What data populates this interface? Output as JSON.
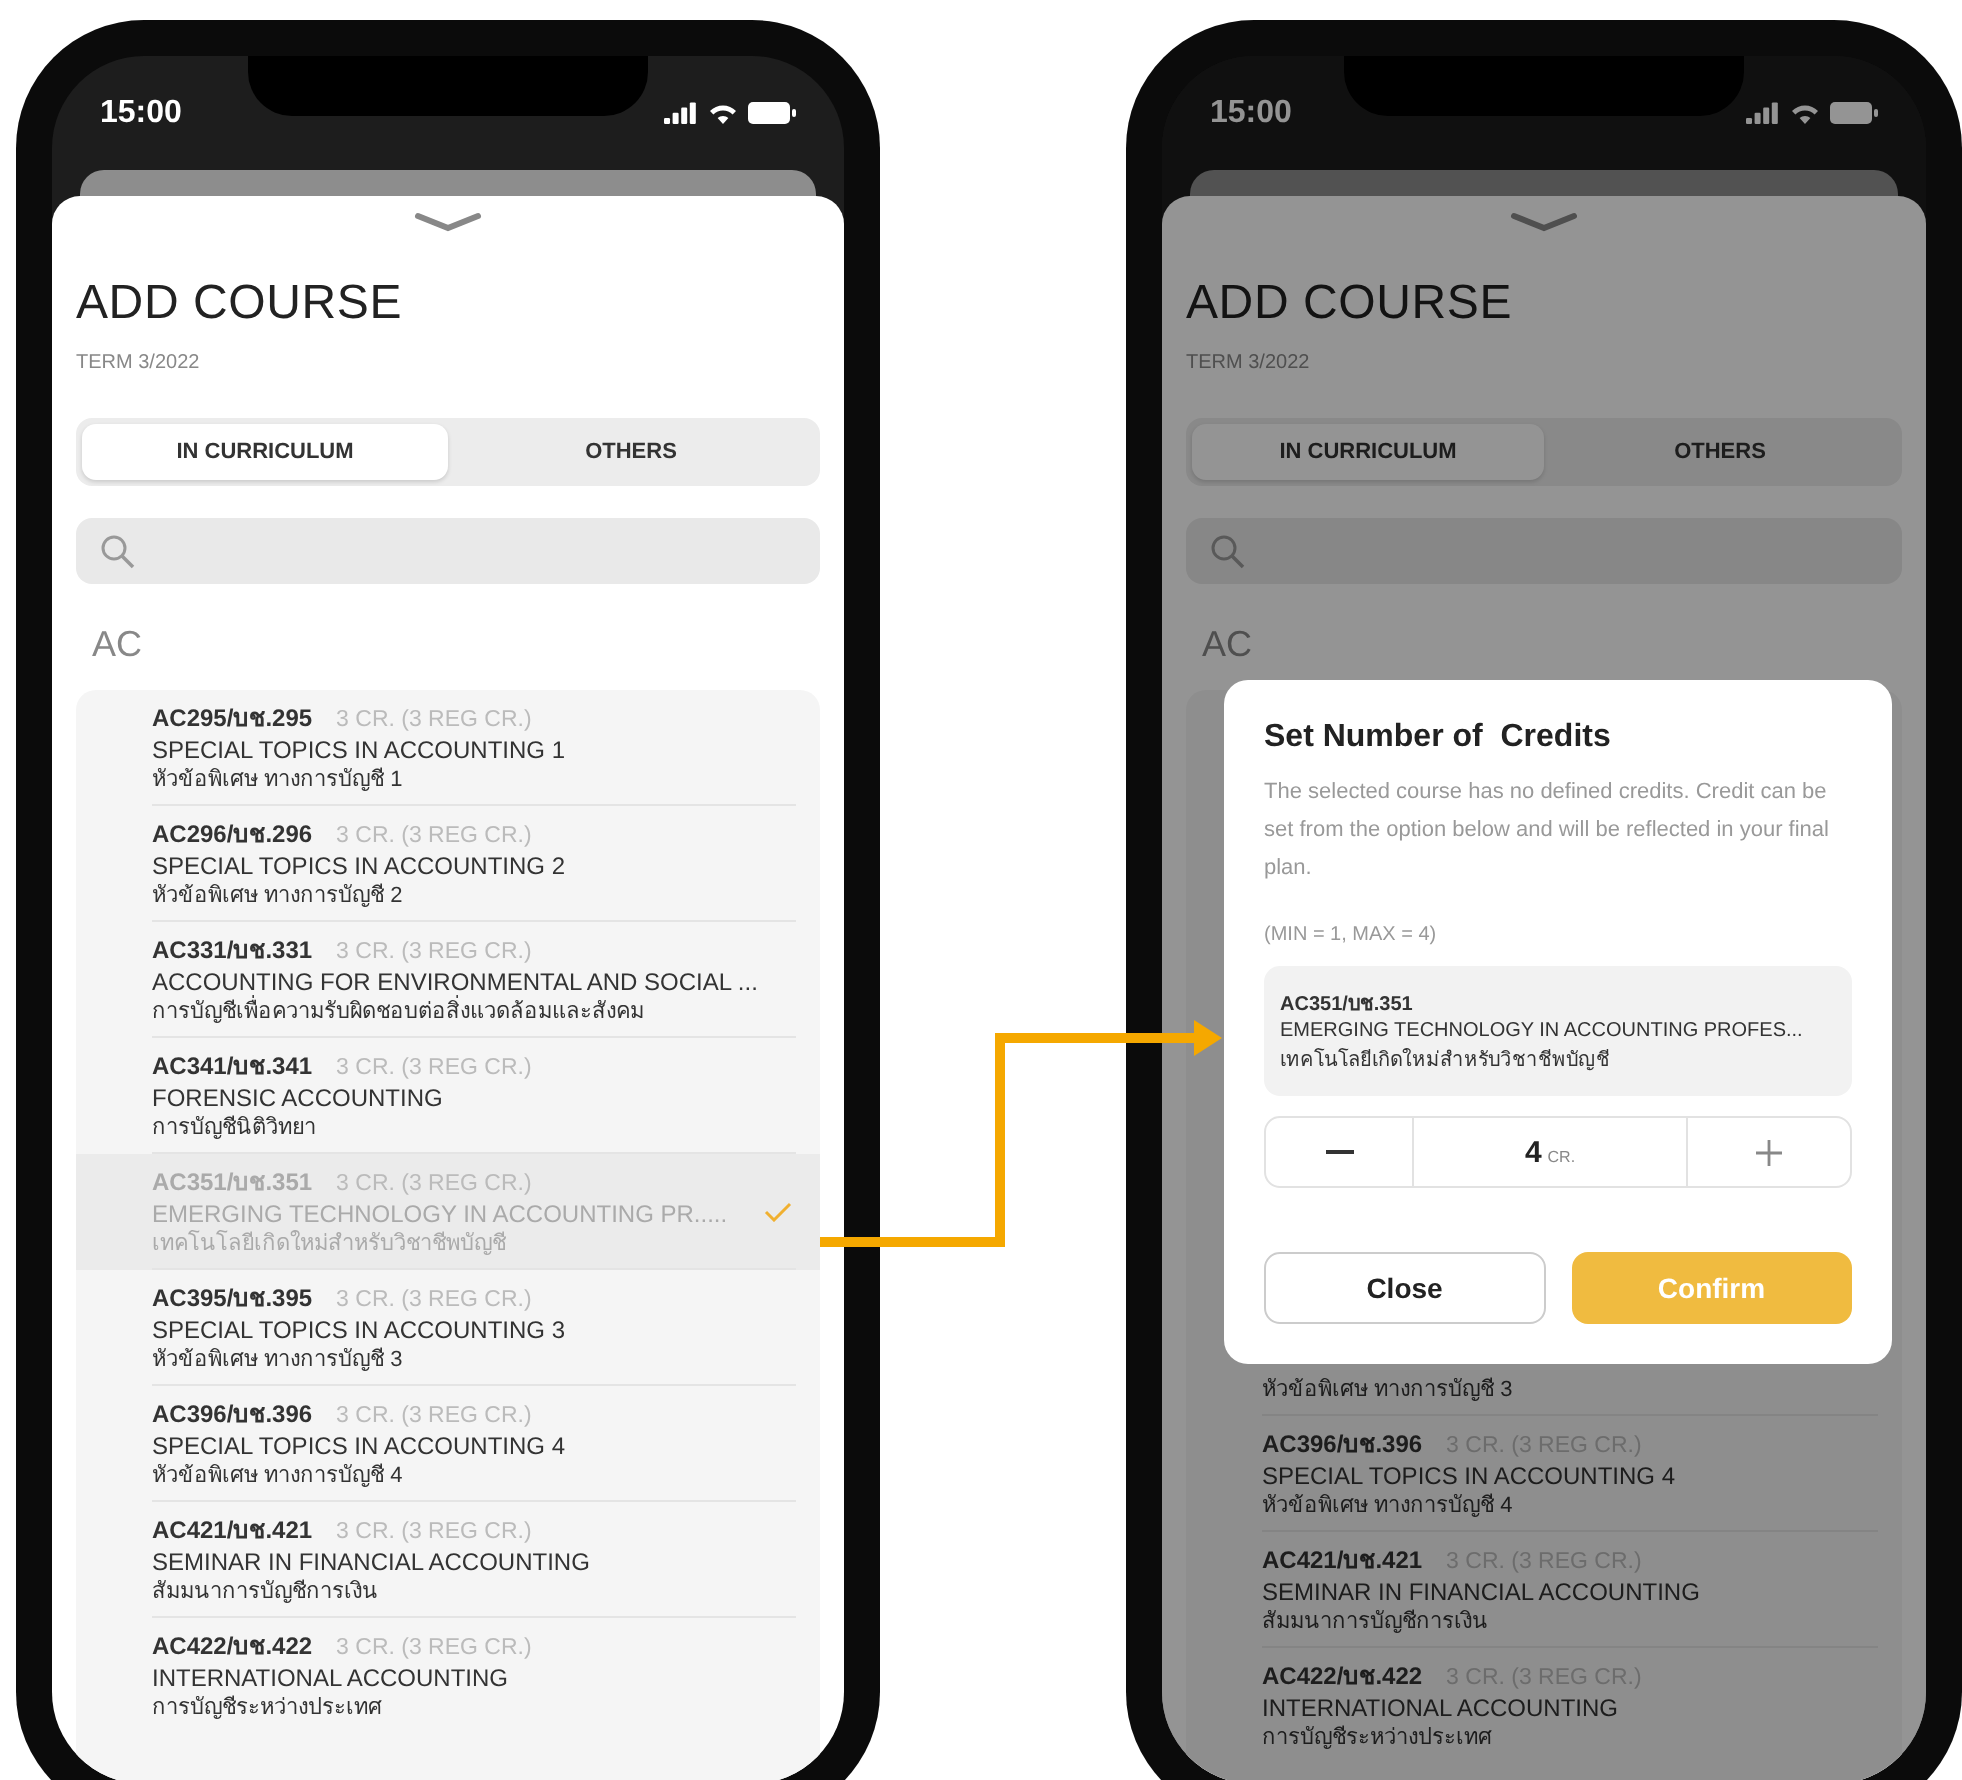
{
  "course_picker": {
    "status_time": "15:00",
    "title": "ADD COURSE",
    "term": "TERM 3/2022",
    "tabs": [
      {
        "label": "IN CURRICULUM",
        "selected": true
      },
      {
        "label": "OTHERS",
        "selected": false
      }
    ],
    "section": "AC",
    "courses": [
      {
        "code": "AC295/บช.295",
        "credits": "3 CR.  (3 REG CR.)",
        "name": "SPECIAL TOPICS IN ACCOUNTING 1",
        "thai": "หัวข้อพิเศษ ทางการบัญชี 1",
        "selected": false
      },
      {
        "code": "AC296/บช.296",
        "credits": "3 CR.  (3 REG CR.)",
        "name": "SPECIAL TOPICS IN ACCOUNTING 2",
        "thai": "หัวข้อพิเศษ ทางการบัญชี 2",
        "selected": false
      },
      {
        "code": "AC331/บช.331",
        "credits": "3 CR.  (3 REG CR.)",
        "name": "ACCOUNTING FOR ENVIRONMENTAL AND SOCIAL ...",
        "thai": "การบัญชีเพื่อความรับผิดชอบต่อสิ่งแวดล้อมและสังคม",
        "selected": false
      },
      {
        "code": "AC341/บช.341",
        "credits": "3 CR.  (3 REG CR.)",
        "name": "FORENSIC ACCOUNTING",
        "thai": "การบัญชีนิติวิทยา",
        "selected": false
      },
      {
        "code": "AC351/บช.351",
        "credits": "3 CR.  (3 REG CR.)",
        "name": "EMERGING TECHNOLOGY IN ACCOUNTING PR.....",
        "thai": "เทคโนโลยีเกิดใหม่สำหรับวิชาชีพบัญชี",
        "selected": true
      },
      {
        "code": "AC395/บช.395",
        "credits": "3 CR.  (3 REG CR.)",
        "name": "SPECIAL TOPICS IN ACCOUNTING 3",
        "thai": "หัวข้อพิเศษ ทางการบัญชี 3",
        "selected": false
      },
      {
        "code": "AC396/บช.396",
        "credits": "3 CR.  (3 REG CR.)",
        "name": "SPECIAL TOPICS IN ACCOUNTING 4",
        "thai": "หัวข้อพิเศษ ทางการบัญชี 4",
        "selected": false
      },
      {
        "code": "AC421/บช.421",
        "credits": "3 CR.  (3 REG CR.)",
        "name": "SEMINAR IN FINANCIAL ACCOUNTING",
        "thai": "สัมมนาการบัญชีการเงิน",
        "selected": false
      },
      {
        "code": "AC422/บช.422",
        "credits": "3 CR.  (3 REG CR.)",
        "name": "INTERNATIONAL ACCOUNTING",
        "thai": "การบัญชีระหว่างประเทศ",
        "selected": false
      }
    ]
  },
  "credit_screen": {
    "status_time": "15:00",
    "title": "ADD COURSE",
    "term": "TERM 3/2022",
    "tabs": [
      {
        "label": "IN CURRICULUM",
        "selected": true
      },
      {
        "label": "OTHERS",
        "selected": false
      }
    ],
    "section": "AC",
    "courses": [
      {
        "thai": "หัวข้อพิเศษ ทางการบัญชี 3",
        "selected": false
      },
      {
        "code": "AC396/บช.396",
        "credits": "3 CR.  (3 REG CR.)",
        "name": "SPECIAL TOPICS IN ACCOUNTING 4",
        "thai": "หัวข้อพิเศษ ทางการบัญชี 4",
        "selected": false
      },
      {
        "code": "AC421/บช.421",
        "credits": "3 CR.  (3 REG CR.)",
        "name": "SEMINAR IN FINANCIAL ACCOUNTING",
        "thai": "สัมมนาการบัญชีการเงิน",
        "selected": false
      },
      {
        "code": "AC422/บช.422",
        "credits": "3 CR.  (3 REG CR.)",
        "name": "INTERNATIONAL ACCOUNTING",
        "thai": "การบัญชีระหว่างประเทศ",
        "selected": false
      }
    ],
    "dialog": {
      "title": "Set Number of  Credits",
      "description": "The selected course has no defined credits. Credit can be set from the option below and will be reflected in your final plan.",
      "limits": "(MIN = 1, MAX = 4)",
      "course": {
        "code": "AC351/บช.351",
        "name": "EMERGING TECHNOLOGY IN ACCOUNTING PROFES...",
        "thai": "เทคโนโลยีเกิดใหม่สำหรับวิชาชีพบัญชี"
      },
      "value": "4",
      "unit": "CR.",
      "buttons": [
        {
          "label": "Close",
          "kind": "secondary"
        },
        {
          "label": "Confirm",
          "kind": "primary"
        }
      ]
    }
  }
}
